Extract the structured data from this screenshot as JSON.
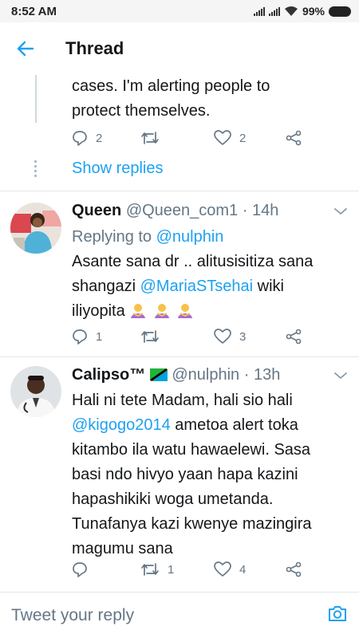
{
  "status_bar": {
    "time": "8:52 AM",
    "battery": "99%"
  },
  "header": {
    "title": "Thread"
  },
  "top_tweet": {
    "lines": [
      "cases. I'm alerting people to",
      "protect themselves."
    ],
    "replies": "2",
    "retweets": "",
    "likes": "2",
    "show_replies": "Show replies"
  },
  "tweets": [
    {
      "name": "Queen",
      "handle": "@Queen_com1",
      "time": "· 14h",
      "replying_prefix": "Replying to",
      "replying_to": "@nulphin",
      "text_1": "Asante sana dr .. alitusisitiza sana",
      "text_2a": "shangazi ",
      "mention": "@MariaSTsehai",
      "text_2b": " wiki",
      "text_3": "iliyopita",
      "replies": "1",
      "retweets": "",
      "likes": "3"
    },
    {
      "name": "Calipso™",
      "handle": "@nulphin",
      "time": "· 13h",
      "text_1": "Hali ni tete Madam, hali sio hali",
      "mention": "@kigogo2014",
      "text_2b": " ametoa alert toka",
      "text_3": "kitambo ila watu hawaelewi. Sasa",
      "text_4": "basi ndo hivyo yaan hapa kazini",
      "text_5": "hapashikiki woga umetanda.",
      "text_6": "Tunafanya kazi kwenye mazingira",
      "text_7": "magumu sana",
      "replies": "",
      "retweets": "1",
      "likes": "4"
    }
  ],
  "reply_bar": {
    "placeholder": "Tweet your reply"
  },
  "colors": {
    "accent": "#1da1f2",
    "muted": "#657786",
    "divider": "#e1e8ed"
  }
}
